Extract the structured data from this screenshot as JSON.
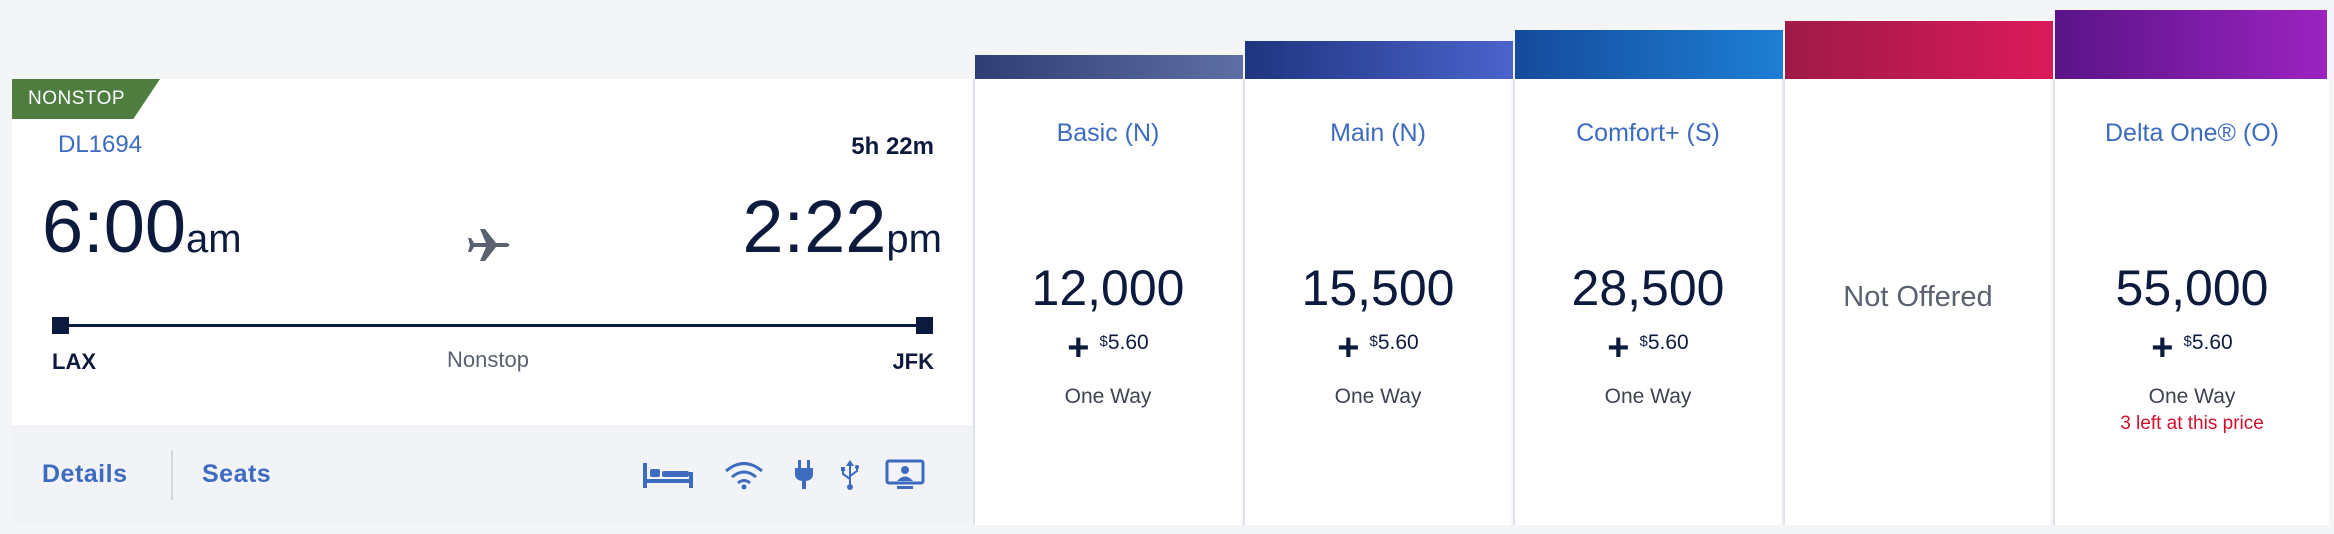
{
  "flight": {
    "badge": "NONSTOP",
    "number": "DL1694",
    "duration": "5h 22m",
    "departure": {
      "time": "6:00",
      "meridiem": "am",
      "airport": "LAX"
    },
    "arrival": {
      "time": "2:22",
      "meridiem": "pm",
      "airport": "JFK"
    },
    "stops": "Nonstop",
    "footer": {
      "details": "Details",
      "seats": "Seats"
    },
    "amenities": [
      "flat-bed-icon",
      "wifi-icon",
      "power-outlet-icon",
      "usb-icon",
      "personal-screen-icon"
    ]
  },
  "fares": [
    {
      "name": "Basic (N)",
      "price": "12,000",
      "tax_currency": "$",
      "tax_amount": "5.60",
      "trip": "One Way",
      "color_start": "#2f3f74",
      "color_end": "#5e6fa6"
    },
    {
      "name": "Main (N)",
      "price": "15,500",
      "tax_currency": "$",
      "tax_amount": "5.60",
      "trip": "One Way",
      "color_start": "#1f3580",
      "color_end": "#4b63cc"
    },
    {
      "name": "Comfort+ (S)",
      "price": "28,500",
      "tax_currency": "$",
      "tax_amount": "5.60",
      "trip": "One Way",
      "color_start": "#154a9c",
      "color_end": "#1d7fd4"
    },
    {
      "name": "",
      "status": "Not Offered",
      "color_start": "#9e1a47",
      "color_end": "#dc1a5a"
    },
    {
      "name": "Delta One® (O)",
      "price": "55,000",
      "tax_currency": "$",
      "tax_amount": "5.60",
      "trip": "One Way",
      "warning": "3 left at this price",
      "color_start": "#5a1488",
      "color_end": "#9b23c0"
    }
  ],
  "colors": {
    "accent": "#3c6bbf",
    "navy": "#0c1a3d",
    "nonstop_green": "#4e7d3f",
    "warning_red": "#d0102b"
  }
}
